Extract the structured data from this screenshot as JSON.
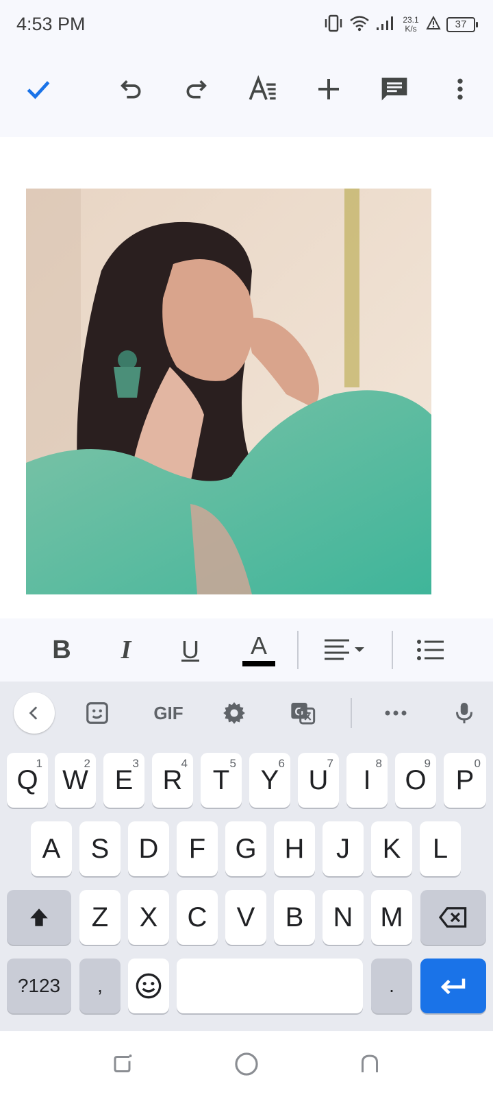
{
  "status_bar": {
    "time": "4:53 PM",
    "net_speed_value": "23.1",
    "net_speed_unit": "K/s",
    "battery": "37"
  },
  "toolbar": {
    "icons": [
      "check-icon",
      "undo-icon",
      "redo-icon",
      "text-format-icon",
      "insert-icon",
      "comment-icon",
      "more-icon"
    ]
  },
  "document": {
    "image_description_icon": "photo-portrait"
  },
  "format_bar": {
    "bold": "B",
    "italic": "I",
    "underline": "U",
    "text_color": "A",
    "text_color_value": "#000000"
  },
  "keyboard": {
    "toolbar": {
      "gif": "GIF"
    },
    "row1": [
      {
        "key": "Q",
        "hint": "1"
      },
      {
        "key": "W",
        "hint": "2"
      },
      {
        "key": "E",
        "hint": "3"
      },
      {
        "key": "R",
        "hint": "4"
      },
      {
        "key": "T",
        "hint": "5"
      },
      {
        "key": "Y",
        "hint": "6"
      },
      {
        "key": "U",
        "hint": "7"
      },
      {
        "key": "I",
        "hint": "8"
      },
      {
        "key": "O",
        "hint": "9"
      },
      {
        "key": "P",
        "hint": "0"
      }
    ],
    "row2": [
      "A",
      "S",
      "D",
      "F",
      "G",
      "H",
      "J",
      "K",
      "L"
    ],
    "row3": [
      "Z",
      "X",
      "C",
      "V",
      "B",
      "N",
      "M"
    ],
    "row4": {
      "symbols": "?123",
      "comma": ",",
      "period": "."
    }
  },
  "colors": {
    "accent": "#1a73e8",
    "surface": "#f7f8fd",
    "keyboard_bg": "#e8eaf0",
    "icon": "#444746"
  }
}
